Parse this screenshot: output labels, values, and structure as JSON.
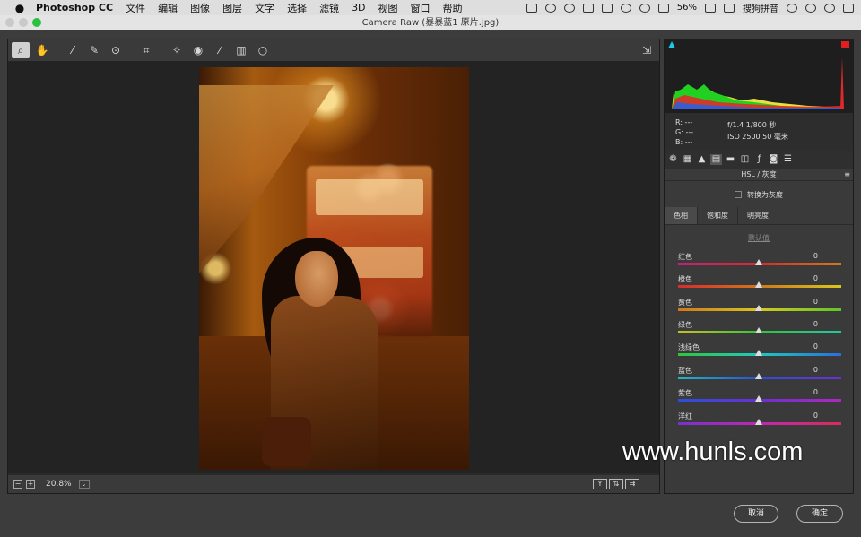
{
  "menubar": {
    "app_name": "Photoshop CC",
    "items": [
      "文件",
      "编辑",
      "图像",
      "图层",
      "文字",
      "选择",
      "滤镜",
      "3D",
      "视图",
      "窗口",
      "帮助"
    ],
    "battery": "56%",
    "ime": "搜狗拼音"
  },
  "window": {
    "title": "Camera Raw (暴暴蓝1 原片.jpg)"
  },
  "status": {
    "zoom": "20.8%",
    "view_y": "Y"
  },
  "info": {
    "r": "R:   ---",
    "g": "G:   ---",
    "b": "B:   ---",
    "aperture_shutter": "f/1.4    1/800 秒",
    "iso_focal": "ISO 2500    50 毫米"
  },
  "panel": {
    "title": "HSL / 灰度",
    "grayscale_label": "转换为灰度",
    "tabs": [
      "色相",
      "饱和度",
      "明亮度"
    ],
    "default_link": "默认值",
    "sliders": [
      {
        "label": "红色",
        "value": "0"
      },
      {
        "label": "橙色",
        "value": "0"
      },
      {
        "label": "黄色",
        "value": "0"
      },
      {
        "label": "绿色",
        "value": "0"
      },
      {
        "label": "浅绿色",
        "value": "0"
      },
      {
        "label": "蓝色",
        "value": "0"
      },
      {
        "label": "紫色",
        "value": "0"
      },
      {
        "label": "洋红",
        "value": "0"
      }
    ]
  },
  "buttons": {
    "cancel": "取消",
    "ok": "确定"
  },
  "watermark": "www.hunls.com"
}
